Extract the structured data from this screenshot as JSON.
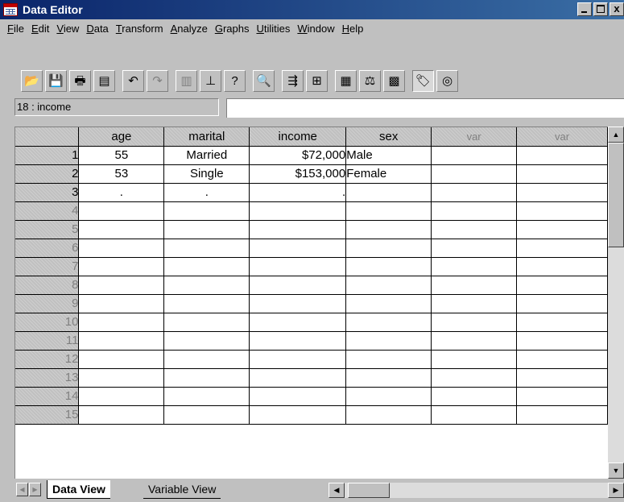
{
  "window": {
    "title": "Data Editor",
    "controls": {
      "minimize": "_",
      "maximize": "□",
      "close": "x"
    }
  },
  "menubar": {
    "items": [
      {
        "key": "F",
        "rest": "ile"
      },
      {
        "key": "E",
        "rest": "dit"
      },
      {
        "key": "V",
        "rest": "iew"
      },
      {
        "key": "D",
        "rest": "ata"
      },
      {
        "key": "T",
        "rest": "ransform"
      },
      {
        "key": "A",
        "rest": "nalyze"
      },
      {
        "key": "G",
        "rest": "raphs"
      },
      {
        "key": "U",
        "rest": "tilities"
      },
      {
        "key": "W",
        "rest": "indow"
      },
      {
        "key": "H",
        "rest": "elp"
      }
    ]
  },
  "toolbar": {
    "buttons": [
      {
        "name": "open-file",
        "glyph": "📂"
      },
      {
        "name": "save-file",
        "glyph": "💾"
      },
      {
        "name": "print",
        "glyph": "🖶"
      },
      {
        "name": "dialog-recall",
        "glyph": "▤"
      },
      {
        "name": "undo",
        "glyph": "↶"
      },
      {
        "name": "redo",
        "glyph": "↷"
      },
      {
        "name": "goto-chart",
        "glyph": "▥"
      },
      {
        "name": "goto-case",
        "glyph": "⊥"
      },
      {
        "name": "variables",
        "glyph": "?"
      },
      {
        "name": "find",
        "glyph": "🔍"
      },
      {
        "name": "insert-cases",
        "glyph": "⇶"
      },
      {
        "name": "insert-variable",
        "glyph": "⊞"
      },
      {
        "name": "split-file",
        "glyph": "▦"
      },
      {
        "name": "weight-cases",
        "glyph": "⚖"
      },
      {
        "name": "select-cases",
        "glyph": "▩"
      },
      {
        "name": "value-labels",
        "glyph": "🏷"
      },
      {
        "name": "use-sets",
        "glyph": "◎"
      }
    ]
  },
  "cellref": {
    "label": "18 : income",
    "value": ""
  },
  "grid": {
    "columns": [
      "age",
      "marital",
      "income",
      "sex",
      "var",
      "var"
    ],
    "rows": [
      {
        "num": "1",
        "age": "55",
        "marital": "Married",
        "income": "$72,000",
        "sex": "Male"
      },
      {
        "num": "2",
        "age": "53",
        "marital": "Single",
        "income": "$153,000",
        "sex": "Female"
      },
      {
        "num": "3",
        "age": ".",
        "marital": ".",
        "income": ".",
        "sex": ""
      },
      {
        "num": "4",
        "age": "",
        "marital": "",
        "income": "",
        "sex": ""
      },
      {
        "num": "5",
        "age": "",
        "marital": "",
        "income": "",
        "sex": ""
      },
      {
        "num": "6",
        "age": "",
        "marital": "",
        "income": "",
        "sex": ""
      },
      {
        "num": "7",
        "age": "",
        "marital": "",
        "income": "",
        "sex": ""
      },
      {
        "num": "8",
        "age": "",
        "marital": "",
        "income": "",
        "sex": ""
      },
      {
        "num": "9",
        "age": "",
        "marital": "",
        "income": "",
        "sex": ""
      },
      {
        "num": "10",
        "age": "",
        "marital": "",
        "income": "",
        "sex": ""
      },
      {
        "num": "11",
        "age": "",
        "marital": "",
        "income": "",
        "sex": ""
      },
      {
        "num": "12",
        "age": "",
        "marital": "",
        "income": "",
        "sex": ""
      },
      {
        "num": "13",
        "age": "",
        "marital": "",
        "income": "",
        "sex": ""
      },
      {
        "num": "14",
        "age": "",
        "marital": "",
        "income": "",
        "sex": ""
      },
      {
        "num": "15",
        "age": "",
        "marital": "",
        "income": "",
        "sex": ""
      }
    ]
  },
  "tabs": {
    "active": "Data View",
    "inactive": "Variable View"
  },
  "scrollbar_glyphs": {
    "up": "▲",
    "down": "▼",
    "left": "◀",
    "right": "▶"
  }
}
